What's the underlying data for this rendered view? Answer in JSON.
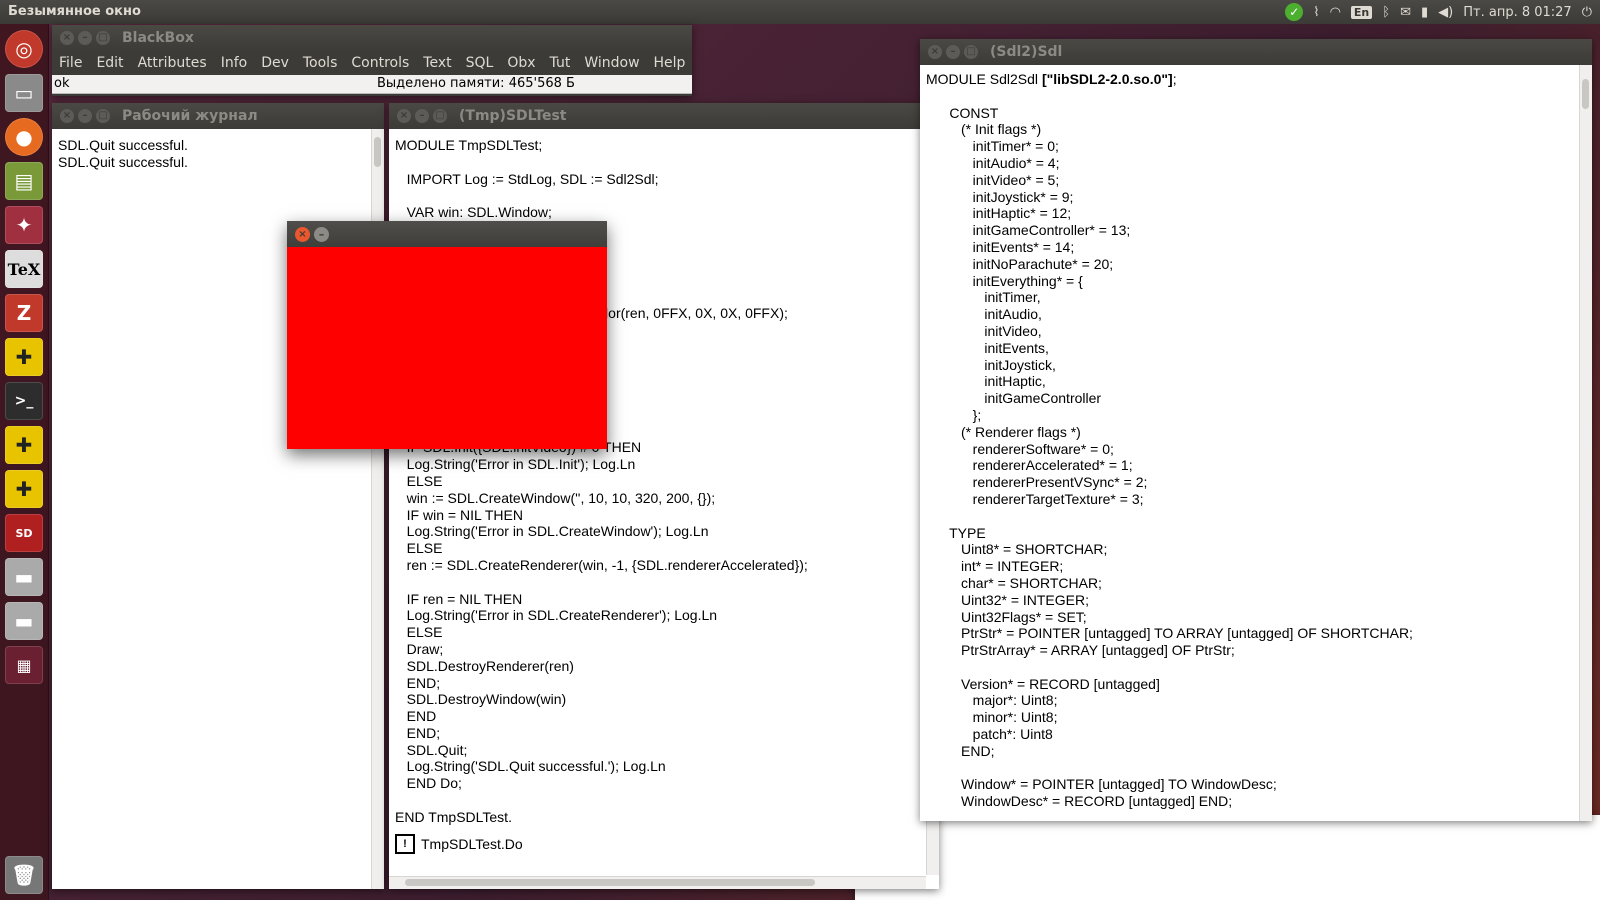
{
  "top_panel": {
    "title": "Безымянное окно",
    "language": "En",
    "clock": "Пт. апр.  8 01:27",
    "icons": [
      "check-icon",
      "paperclip-icon",
      "wifi-icon",
      "bluetooth-icon",
      "mail-icon",
      "battery-icon",
      "volume-icon",
      "power-icon"
    ]
  },
  "launcher": {
    "items": [
      "ubuntu-dash-icon",
      "files-icon",
      "firefox-icon",
      "libreoffice-icon",
      "dragon-icon",
      "tex-icon",
      "zotero-icon",
      "puzzle-icon",
      "terminal-icon",
      "puzzle-icon-2",
      "puzzle-icon-3",
      "sd-card-icon",
      "drive-icon",
      "drive-icon-2",
      "workspace-icon",
      "trash-icon"
    ]
  },
  "blackbox": {
    "title": "BlackBox",
    "menu": [
      "File",
      "Edit",
      "Attributes",
      "Info",
      "Dev",
      "Tools",
      "Controls",
      "Text",
      "SQL",
      "Obx",
      "Tut",
      "Window",
      "Help"
    ],
    "status_left": "ok",
    "status_right": "Выделено памяти: 465'568 Б"
  },
  "log_window": {
    "title": "Рабочий журнал",
    "lines": "SDL.Quit successful.\nSDL.Quit successful."
  },
  "sdltest_window": {
    "title": "(Tmp)SDLTest",
    "code": "MODULE TmpSDLTest;\n\n   IMPORT Log := StdLog, SDL := Sdl2Sdl;\n\n   VAR win: SDL.Window;\n\n\n\n\n\n                                                    olor(ren, 0FFX, 0X, 0X, 0FFX);\n\n\n\n\n\n\n\n   IF SDL.Init({SDL.initVideo}) # 0 THEN\n   Log.String('Error in SDL.Init'); Log.Ln\n   ELSE\n   win := SDL.CreateWindow('', 10, 10, 320, 200, {});\n   IF win = NIL THEN\n   Log.String('Error in SDL.CreateWindow'); Log.Ln\n   ELSE\n   ren := SDL.CreateRenderer(win, -1, {SDL.rendererAccelerated});\n\n   IF ren = NIL THEN\n   Log.String('Error in SDL.CreateRenderer'); Log.Ln\n   ELSE\n   Draw;\n   SDL.DestroyRenderer(ren)\n   END;\n   SDL.DestroyWindow(win)\n   END\n   END;\n   SDL.Quit;\n   Log.String('SDL.Quit successful.'); Log.Ln\n   END Do;\n\nEND TmpSDLTest.",
    "commander_label": "TmpSDLTest.Do"
  },
  "sdl2sdl_window": {
    "title": "(Sdl2)Sdl",
    "header_prefix": "MODULE Sdl2Sdl ",
    "header_lib": "[\"libSDL2-2.0.so.0\"]",
    "header_suffix": ";",
    "code": "\n      CONST\n         (* Init flags *)\n            initTimer* = 0;\n            initAudio* = 4;\n            initVideo* = 5;\n            initJoystick* = 9;\n            initHaptic* = 12;\n            initGameController* = 13;\n            initEvents* = 14;\n            initNoParachute* = 20;\n            initEverything* = {\n               initTimer,\n               initAudio,\n               initVideo,\n               initEvents,\n               initJoystick,\n               initHaptic,\n               initGameController\n            };\n         (* Renderer flags *)\n            rendererSoftware* = 0;\n            rendererAccelerated* = 1;\n            rendererPresentVSync* = 2;\n            rendererTargetTexture* = 3;\n\n      TYPE\n         Uint8* = SHORTCHAR;\n         int* = INTEGER;\n         char* = SHORTCHAR;\n         Uint32* = INTEGER;\n         Uint32Flags* = SET;\n         PtrStr* = POINTER [untagged] TO ARRAY [untagged] OF SHORTCHAR;\n         PtrStrArray* = ARRAY [untagged] OF PtrStr;\n\n         Version* = RECORD [untagged]\n            major*: Uint8;\n            minor*: Uint8;\n            patch*: Uint8\n         END;\n\n         Window* = POINTER [untagged] TO WindowDesc;\n         WindowDesc* = RECORD [untagged] END;"
  },
  "sdl_window": {
    "color": "#ff0000"
  }
}
